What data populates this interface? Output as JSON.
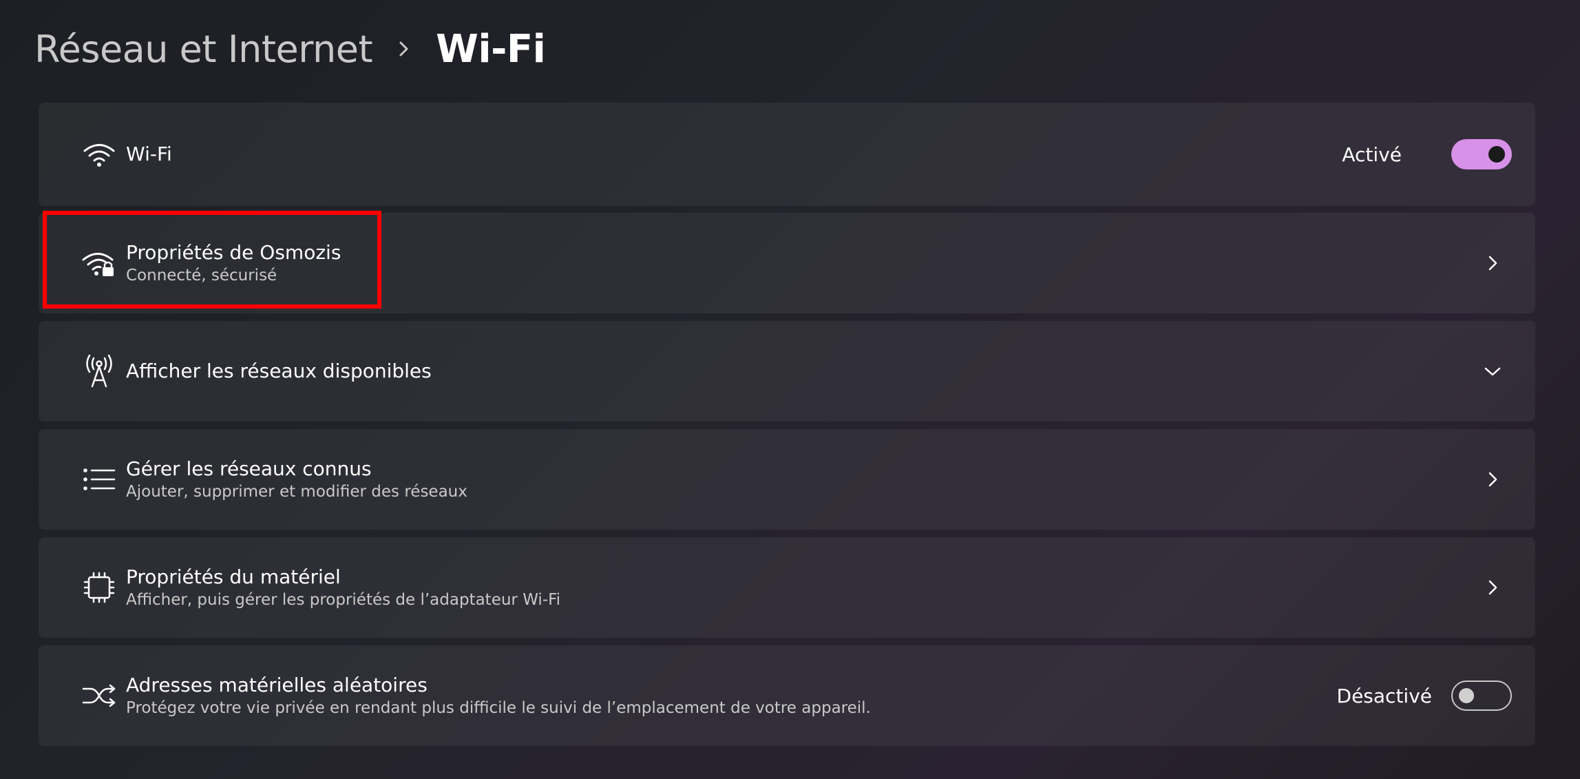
{
  "breadcrumb": {
    "parent": "Réseau et Internet",
    "current": "Wi-Fi"
  },
  "rows": {
    "wifi": {
      "title": "Wi-Fi",
      "status_label": "Activé",
      "toggle_on": true,
      "icon": "wifi-icon"
    },
    "network_properties": {
      "title": "Propriétés de Osmozis",
      "subtitle": "Connecté, sécurisé",
      "icon": "wifi-lock-icon"
    },
    "available_networks": {
      "title": "Afficher les réseaux disponibles",
      "icon": "antenna-icon"
    },
    "known_networks": {
      "title": "Gérer les réseaux connus",
      "subtitle": "Ajouter, supprimer et modifier des réseaux",
      "icon": "list-icon"
    },
    "hardware_properties": {
      "title": "Propriétés du matériel",
      "subtitle": "Afficher, puis gérer les propriétés de l’adaptateur Wi-Fi",
      "icon": "chip-icon"
    },
    "random_addresses": {
      "title": "Adresses matérielles aléatoires",
      "subtitle": "Protégez votre vie privée en rendant plus difficile le suivi de l’emplacement de votre appareil.",
      "status_label": "Désactivé",
      "toggle_on": false,
      "icon": "shuffle-icon"
    }
  },
  "colors": {
    "accent": "#d891e8",
    "highlight": "#ff0000",
    "card_background": "#2a2b31"
  }
}
